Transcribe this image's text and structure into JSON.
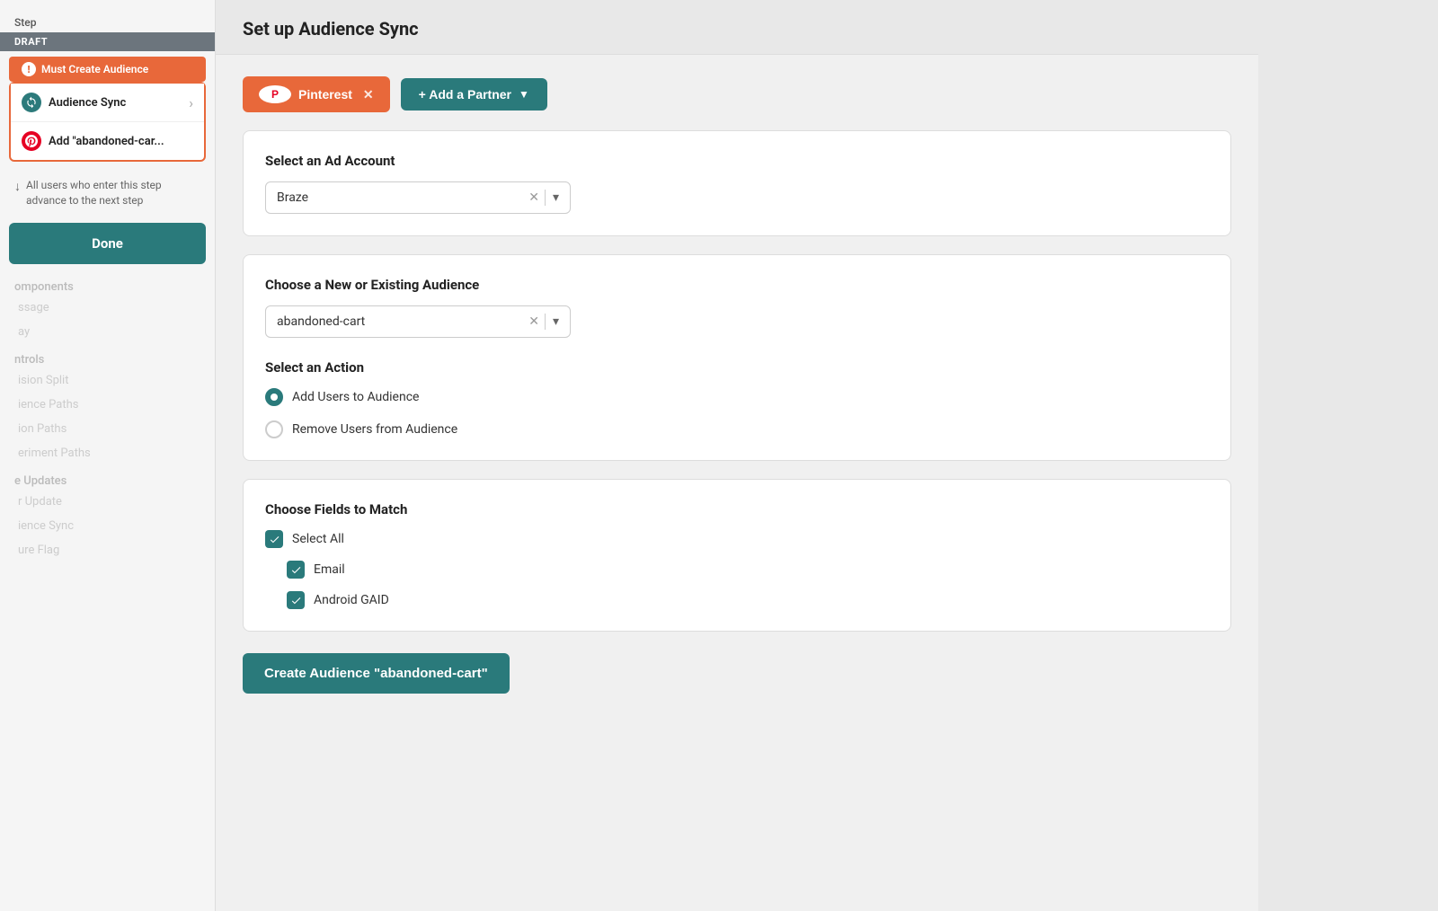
{
  "sidebar": {
    "step_label": "Step",
    "draft_badge": "DRAFT",
    "must_create_label": "Must Create Audience",
    "steps": [
      {
        "id": "audience-sync",
        "label": "Audience Sync",
        "icon": "sync"
      },
      {
        "id": "add-abandoned",
        "label": "Add \"abandoned-car...",
        "icon": "pinterest"
      }
    ],
    "advance_text": "All users who enter this step advance to the next step",
    "done_button": "Done",
    "nav": {
      "components_label": "omponents",
      "sections": [
        {
          "label": "ssage"
        },
        {
          "label": "ay"
        },
        {
          "label": "ntrols"
        },
        {
          "label": "ision Split"
        },
        {
          "label": "ience Paths"
        },
        {
          "label": "ion Paths"
        },
        {
          "label": "eriment Paths"
        },
        {
          "label": "e Updates"
        },
        {
          "label": "r Update"
        },
        {
          "label": "ience Sync"
        },
        {
          "label": "ure Flag"
        }
      ]
    }
  },
  "main": {
    "header_title": "Set up Audience Sync",
    "partner_button": "Pinterest",
    "add_partner_button": "+ Add a Partner",
    "ad_account": {
      "label": "Select an Ad Account",
      "value": "Braze"
    },
    "audience": {
      "label": "Choose a New or Existing Audience",
      "value": "abandoned-cart"
    },
    "action": {
      "label": "Select an Action",
      "options": [
        {
          "id": "add",
          "label": "Add Users to Audience",
          "selected": true
        },
        {
          "id": "remove",
          "label": "Remove Users from Audience",
          "selected": false
        }
      ]
    },
    "fields": {
      "label": "Choose Fields to Match",
      "select_all": "Select All",
      "items": [
        {
          "label": "Email",
          "checked": true
        },
        {
          "label": "Android GAID",
          "checked": true
        }
      ]
    },
    "create_button": "Create Audience \"abandoned-cart\""
  }
}
